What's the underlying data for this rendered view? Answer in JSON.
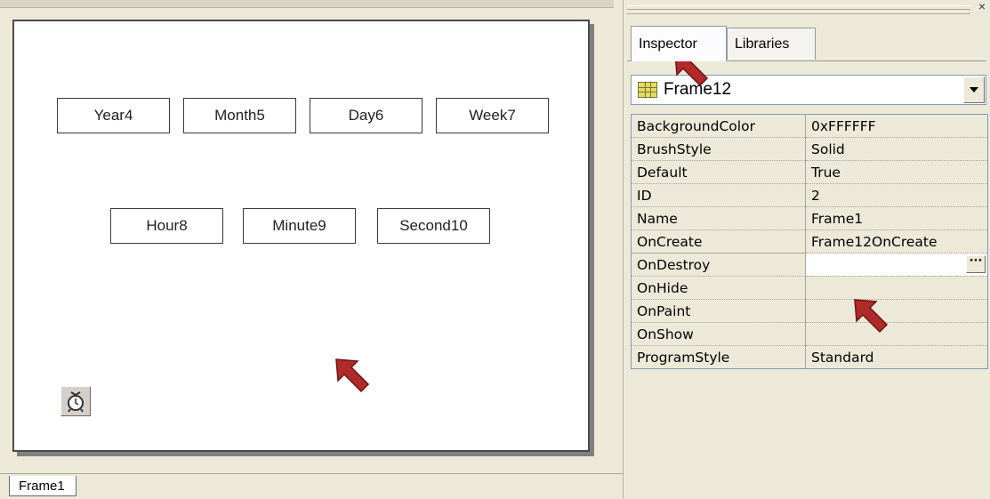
{
  "design": {
    "widgets": {
      "year": "Year4",
      "month": "Month5",
      "day": "Day6",
      "week": "Week7",
      "hour": "Hour8",
      "minute": "Minute9",
      "second": "Second10"
    },
    "timer_icon": "alarm-clock-icon",
    "frame_tab": "Frame1"
  },
  "inspector": {
    "close_label": "×",
    "tabs": {
      "inspector": "Inspector",
      "libraries": "Libraries"
    },
    "selected_object": "Frame12",
    "object_icon": "grid-icon",
    "ellipsis_label": "···",
    "properties": [
      {
        "name": "BackgroundColor",
        "value": "0xFFFFFF"
      },
      {
        "name": "BrushStyle",
        "value": "Solid"
      },
      {
        "name": "Default",
        "value": "True"
      },
      {
        "name": "ID",
        "value": "2"
      },
      {
        "name": "Name",
        "value": "Frame1"
      },
      {
        "name": "OnCreate",
        "value": "Frame12OnCreate"
      },
      {
        "name": "OnDestroy",
        "value": ""
      },
      {
        "name": "OnHide",
        "value": ""
      },
      {
        "name": "OnPaint",
        "value": ""
      },
      {
        "name": "OnShow",
        "value": ""
      },
      {
        "name": "ProgramStyle",
        "value": "Standard"
      }
    ]
  },
  "colors": {
    "arrow": "#b02a2a",
    "panel_bg": "#ece9d8"
  }
}
